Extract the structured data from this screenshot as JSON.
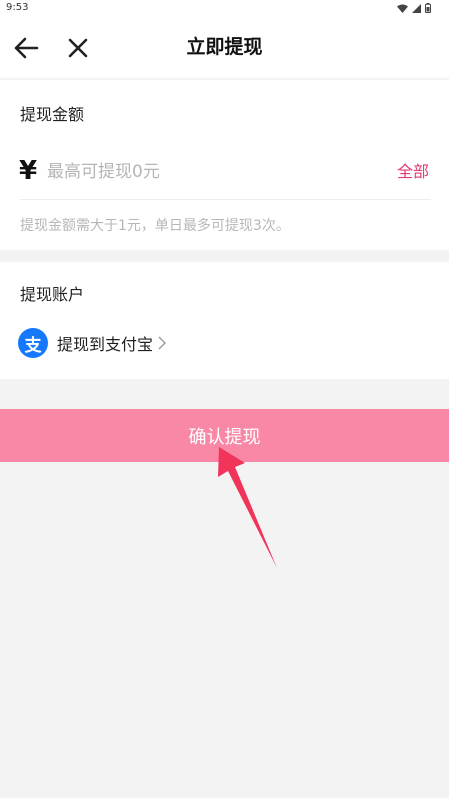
{
  "status_bar": {
    "time": "9:53"
  },
  "header": {
    "title": "立即提现",
    "back_icon": "back-arrow-icon",
    "close_icon": "close-icon"
  },
  "amount_section": {
    "label": "提现金额",
    "currency_symbol": "¥",
    "placeholder": "最高可提现0元",
    "all_button": "全部",
    "hint": "提现金额需大于1元，单日最多可提现3次。"
  },
  "account_section": {
    "label": "提现账户",
    "method_icon_text": "支",
    "method_label": "提现到支付宝"
  },
  "confirm_button": "确认提现",
  "colors": {
    "accent": "#e23a73",
    "confirm_button_bg": "#f888a6",
    "alipay_blue": "#1678ff",
    "annotation_arrow": "#f0345a"
  }
}
